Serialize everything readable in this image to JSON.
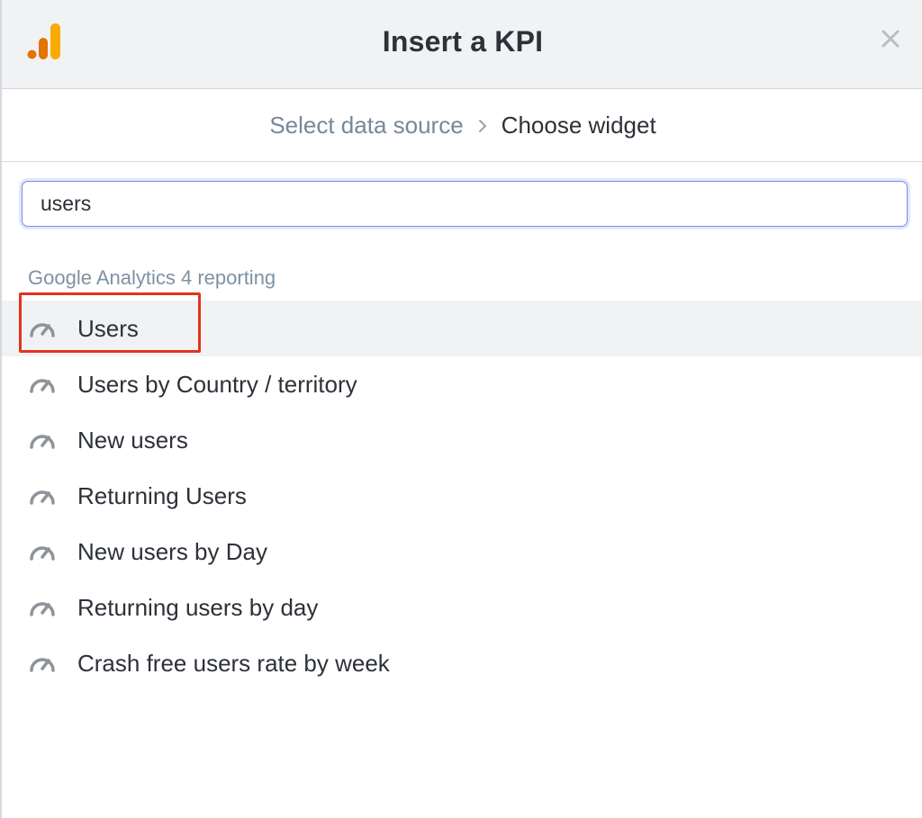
{
  "dialog": {
    "title": "Insert a KPI",
    "close_icon": "close-icon",
    "logo_icon": "google-analytics-logo-icon"
  },
  "breadcrumb": {
    "previous": "Select data source",
    "separator_icon": "chevron-right-icon",
    "current": "Choose widget"
  },
  "search": {
    "value": "users"
  },
  "results": {
    "group_label": "Google Analytics 4 reporting",
    "item_icon": "gauge-icon",
    "items": [
      {
        "label": "Users",
        "selected": true
      },
      {
        "label": "Users by Country / territory"
      },
      {
        "label": "New users"
      },
      {
        "label": "Returning Users"
      },
      {
        "label": "New users by Day"
      },
      {
        "label": "Returning users by day"
      },
      {
        "label": "Crash free users rate by week"
      }
    ]
  },
  "colors": {
    "logo_dark": "#e37400",
    "logo_light": "#f9ab00",
    "highlight": "#e2341d",
    "focus_ring": "#7b8bea",
    "muted_text": "#77889a"
  }
}
